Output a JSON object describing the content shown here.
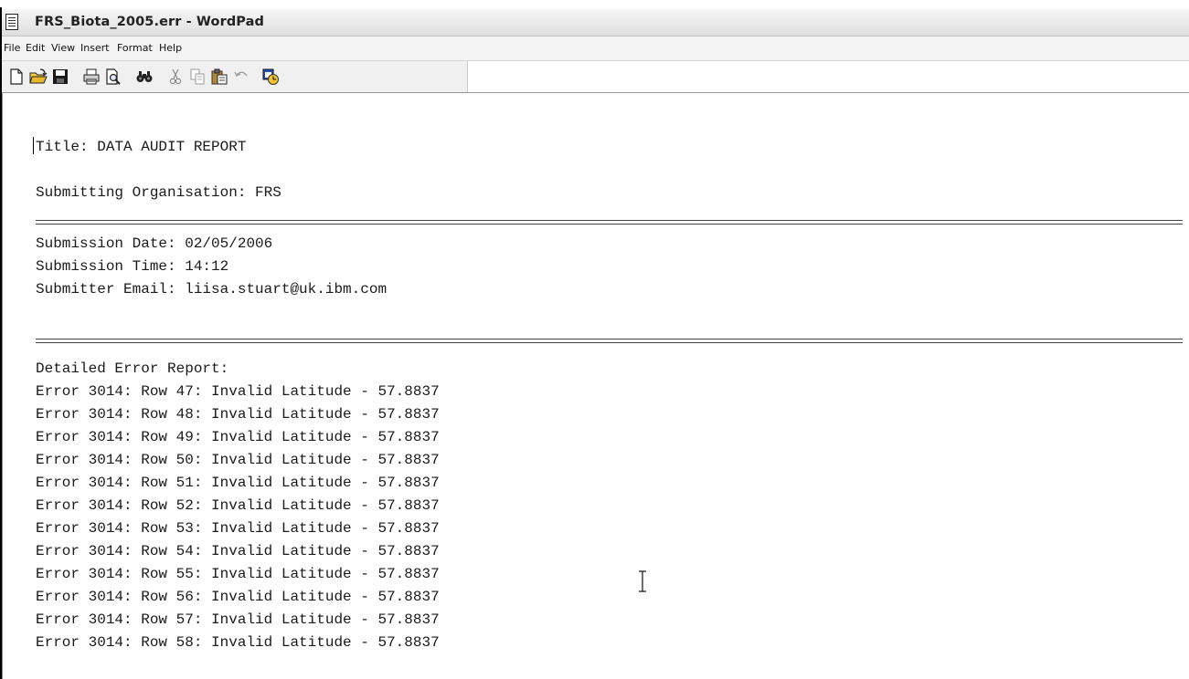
{
  "window": {
    "title": "FRS_Biota_2005.err - WordPad",
    "icon": "document-icon"
  },
  "menu": [
    "File",
    "Edit",
    "View",
    "Insert",
    "Format",
    "Help"
  ],
  "toolbar": {
    "buttons": [
      "new-icon",
      "open-icon",
      "save-icon",
      "print-icon",
      "print-preview-icon",
      "find-icon",
      "cut-icon",
      "copy-icon",
      "paste-icon",
      "undo-icon",
      "insert-date-time-icon"
    ]
  },
  "document": {
    "title_line": "Title: DATA AUDIT REPORT",
    "organisation_line": "Submitting Organisation: FRS",
    "date_line": "Submission Date: 02/05/2006",
    "time_line": "Submission Time: 14:12",
    "email_line": "Submitter Email: liisa.stuart@uk.ibm.com",
    "report_heading": "Detailed Error Report:",
    "errors": [
      "Error 3014: Row 47: Invalid Latitude - 57.8837",
      "Error 3014: Row 48: Invalid Latitude - 57.8837",
      "Error 3014: Row 49: Invalid Latitude - 57.8837",
      "Error 3014: Row 50: Invalid Latitude - 57.8837",
      "Error 3014: Row 51: Invalid Latitude - 57.8837",
      "Error 3014: Row 52: Invalid Latitude - 57.8837",
      "Error 3014: Row 53: Invalid Latitude - 57.8837",
      "Error 3014: Row 54: Invalid Latitude - 57.8837",
      "Error 3014: Row 55: Invalid Latitude - 57.8837",
      "Error 3014: Row 56: Invalid Latitude - 57.8837",
      "Error 3014: Row 57: Invalid Latitude - 57.8837",
      "Error 3014: Row 58: Invalid Latitude - 57.8837"
    ]
  }
}
